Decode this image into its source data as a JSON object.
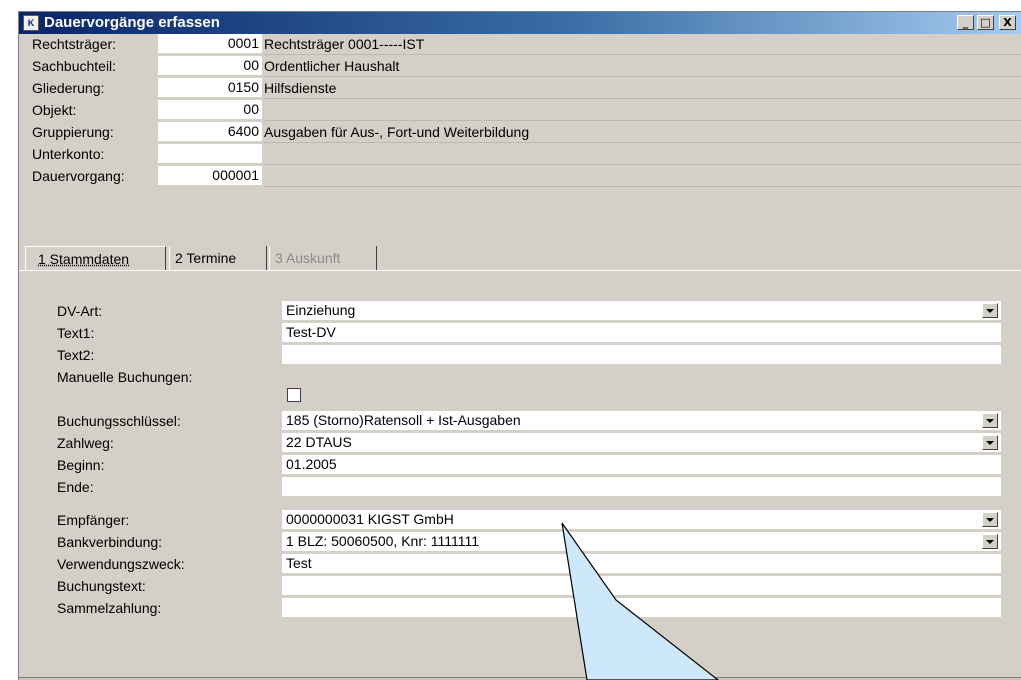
{
  "window": {
    "title": "Dauervorgänge erfassen",
    "controls": {
      "minimize": "_",
      "maximize": "□",
      "close": "X"
    }
  },
  "header_fields": [
    {
      "label": "Rechtsträger:",
      "value": "0001",
      "description": "Rechtsträger 0001-----IST"
    },
    {
      "label": "Sachbuchteil:",
      "value": "00",
      "description": "Ordentlicher Haushalt"
    },
    {
      "label": "Gliederung:",
      "value": "0150",
      "description": "Hilfsdienste"
    },
    {
      "label": "Objekt:",
      "value": "00",
      "description": ""
    },
    {
      "label": "Gruppierung:",
      "value": "6400",
      "description": "Ausgaben für Aus-, Fort-und Weiterbildung"
    },
    {
      "label": "Unterkonto:",
      "value": "",
      "description": ""
    },
    {
      "label": "Dauervorgang:",
      "value": "000001",
      "description": ""
    }
  ],
  "tabs": [
    {
      "label": "1 Stammdaten",
      "state": "active"
    },
    {
      "label": "2 Termine",
      "state": "enabled"
    },
    {
      "label": "3 Auskunft",
      "state": "disabled"
    }
  ],
  "form_fields": [
    {
      "label": "DV-Art:",
      "value": "Einziehung",
      "dropdown": true
    },
    {
      "label": "Text1:",
      "value": "Test-DV",
      "dropdown": false
    },
    {
      "label": "Text2:",
      "value": "",
      "dropdown": false
    },
    {
      "label": "Manuelle Buchungen:",
      "checkbox": true,
      "checked": false
    },
    {
      "label": "Buchungsschlüssel:",
      "value": "185 (Storno)Ratensoll + Ist-Ausgaben",
      "dropdown": true
    },
    {
      "label": "Zahlweg:",
      "value": "22 DTAUS",
      "dropdown": true
    },
    {
      "label": "Beginn:",
      "value": "01.2005",
      "dropdown": false
    },
    {
      "label": "Ende:",
      "value": "",
      "dropdown": false
    },
    {
      "label": "Empfänger:",
      "value": "0000000031  KIGST GmbH",
      "dropdown": true
    },
    {
      "label": "Bankverbindung:",
      "value": "1  BLZ: 50060500, Knr: 1111111",
      "dropdown": true
    },
    {
      "label": "Verwendungszweck:",
      "value": "Test",
      "dropdown": false
    },
    {
      "label": "Buchungstext:",
      "value": "",
      "dropdown": false
    },
    {
      "label": "Sammelzahlung:",
      "value": "",
      "dropdown": false
    }
  ],
  "callout": {
    "fill": "#cce8fa",
    "stroke": "#000000"
  },
  "colors": {
    "titlebar": "#0a246a",
    "window": "#d4d0c8",
    "field": "#ffffff"
  }
}
